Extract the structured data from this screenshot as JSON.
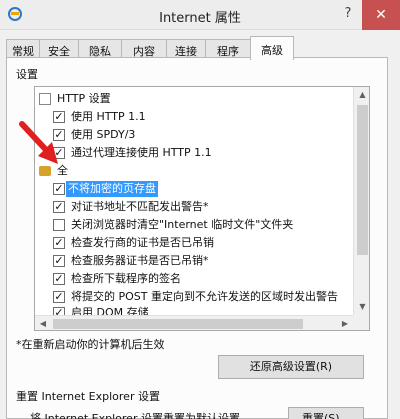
{
  "window": {
    "title": "Internet 属性",
    "help_glyph": "?",
    "close_glyph": "✕"
  },
  "tabs": [
    {
      "label": "常规"
    },
    {
      "label": "安全"
    },
    {
      "label": "隐私"
    },
    {
      "label": "内容"
    },
    {
      "label": "连接"
    },
    {
      "label": "程序"
    },
    {
      "label": "高级"
    }
  ],
  "settings": {
    "group_label": "设置",
    "items": [
      {
        "label": "HTTP 设置"
      },
      {
        "label": "使用 HTTP 1.1",
        "checked": true
      },
      {
        "label": "使用 SPDY/3",
        "checked": true
      },
      {
        "label": "通过代理连接使用 HTTP 1.1",
        "checked": true
      },
      {
        "label": "全"
      },
      {
        "label": "不将加密的页存盘",
        "checked": true,
        "selected": true
      },
      {
        "label": "对证书地址不匹配发出警告*",
        "checked": true
      },
      {
        "label": "关闭浏览器时清空\"Internet 临时文件\"文件夹",
        "checked": false
      },
      {
        "label": "检查发行商的证书是否已吊销",
        "checked": true
      },
      {
        "label": "检查服务器证书是否已吊销*",
        "checked": true
      },
      {
        "label": "检查所下载程序的签名",
        "checked": true
      },
      {
        "label": "将提交的 POST 重定向到不允许发送的区域时发出警告",
        "checked": true
      },
      {
        "label": "启用 DOM 存储",
        "checked": true
      }
    ],
    "check_glyph": "✓",
    "note": "*在重新启动你的计算机后生效",
    "restore_button": "还原高级设置(R)"
  },
  "reset": {
    "group_label": "重置 Internet Explorer 设置",
    "description": "将 Internet Explorer 设置重置为默认设置。",
    "button": "重置(S)..."
  },
  "colors": {
    "selection": "#3399ff",
    "close_button": "#c75050",
    "annotation_arrow": "#e02020"
  }
}
